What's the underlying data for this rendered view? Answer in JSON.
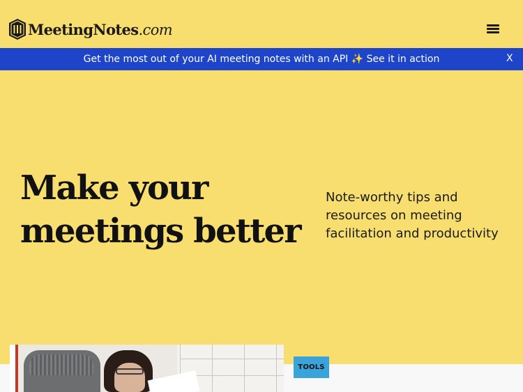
{
  "header": {
    "logo": {
      "brand": "MeetingNotes",
      "tld": ".com"
    },
    "menu_icon": "hamburger-menu-icon"
  },
  "banner": {
    "message": "Get the most out of your AI meeting notes with an API ✨ See it in action",
    "close_label": "X",
    "background": "#1e45c9"
  },
  "hero": {
    "title": "Make your meetings better",
    "subtitle": "Note-worthy tips and resources on meeting facilitation and productivity",
    "background": "#f8de6e"
  },
  "featured_post": {
    "tag": "TOOLS",
    "tag_color": "#3aa3d9"
  }
}
